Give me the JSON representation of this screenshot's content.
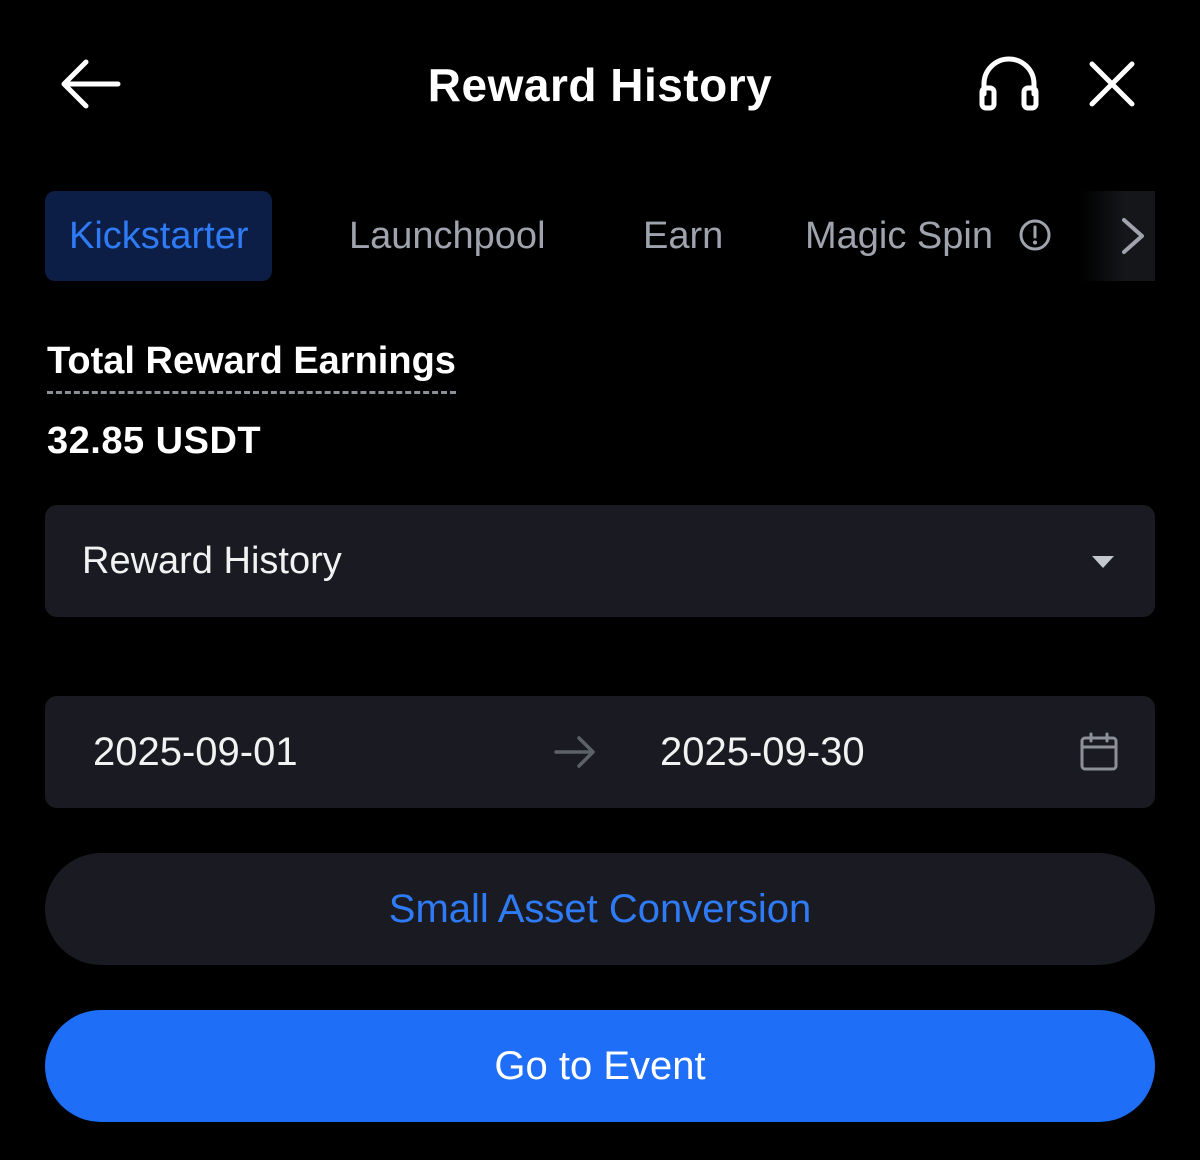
{
  "header": {
    "title": "Reward History",
    "back_icon": "arrow-left-icon",
    "support_icon": "headphones-icon",
    "close_icon": "close-icon"
  },
  "tabs": {
    "items": [
      {
        "label": "Kickstarter",
        "active": true
      },
      {
        "label": "Launchpool",
        "active": false
      },
      {
        "label": "Earn",
        "active": false
      },
      {
        "label": "Magic Spin",
        "active": false,
        "icon": "info-icon"
      }
    ],
    "scroll_icon": "chevron-right-icon"
  },
  "earnings": {
    "label": "Total Reward Earnings",
    "value": "32.85 USDT"
  },
  "filter": {
    "selected": "Reward History",
    "icon": "caret-down-icon"
  },
  "date_range": {
    "start": "2025-09-01",
    "end": "2025-09-30",
    "separator_icon": "arrow-right-icon",
    "calendar_icon": "calendar-icon"
  },
  "actions": {
    "secondary_label": "Small Asset Conversion",
    "primary_label": "Go to Event"
  },
  "colors": {
    "background": "#000000",
    "surface": "#1a1b22",
    "accent": "#2f7bf6",
    "primary_button": "#1e6ef7",
    "active_tab_bg": "#0c1e46",
    "muted_text": "#9ea3ad"
  }
}
